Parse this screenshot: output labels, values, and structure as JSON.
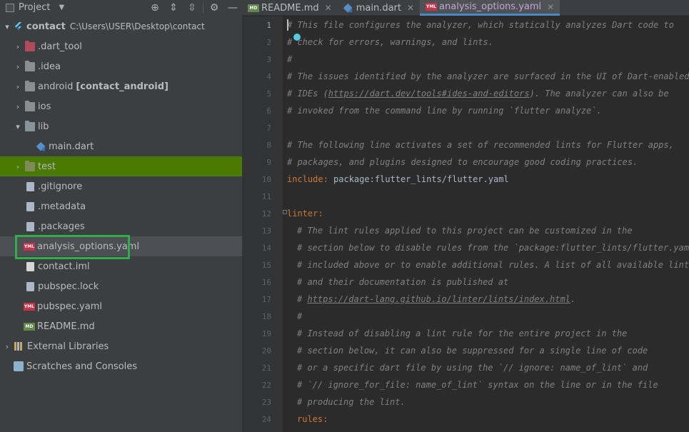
{
  "project_panel": {
    "title": "Project",
    "toolbar_icons": [
      "locate-icon",
      "expand-all-icon",
      "collapse-all-icon",
      "gear-icon",
      "hide-icon"
    ],
    "root": {
      "name": "contact",
      "path": "C:\\Users\\USER\\Desktop\\contact"
    },
    "items": [
      {
        "label": ".dart_tool"
      },
      {
        "label": ".idea"
      },
      {
        "label": "android",
        "extra": "[contact_android]"
      },
      {
        "label": "ios"
      },
      {
        "label": "lib"
      },
      {
        "label": "main.dart"
      },
      {
        "label": "test"
      },
      {
        "label": ".gitignore"
      },
      {
        "label": ".metadata"
      },
      {
        "label": ".packages"
      },
      {
        "label": "analysis_options.yaml"
      },
      {
        "label": "contact.iml"
      },
      {
        "label": "pubspec.lock"
      },
      {
        "label": "pubspec.yaml"
      },
      {
        "label": "README.md"
      },
      {
        "label": "External Libraries"
      },
      {
        "label": "Scratches and Consoles"
      }
    ]
  },
  "tabs": [
    {
      "label": "README.md",
      "icon": "MD"
    },
    {
      "label": "main.dart",
      "icon": "dart"
    },
    {
      "label": "analysis_options.yaml",
      "icon": "YML"
    }
  ],
  "editor": {
    "line_numbers": [
      "1",
      "2",
      "3",
      "4",
      "5",
      "6",
      "7",
      "8",
      "9",
      "10",
      "11",
      "12",
      "13",
      "14",
      "15",
      "16",
      "17",
      "18",
      "19",
      "20",
      "21",
      "22",
      "23",
      "24"
    ],
    "lines": [
      "# This file configures the analyzer, which statically analyzes Dart code to",
      "# check for errors, warnings, and lints.",
      "#",
      "# The issues identified by the analyzer are surfaced in the UI of Dart-enabled",
      "# IDEs (",
      "https://dart.dev/tools#ides-and-editors",
      "). The analyzer can also be",
      "# invoked from the command line by running `flutter analyze`.",
      "# The following line activates a set of recommended lints for Flutter apps,",
      "# packages, and plugins designed to encourage good coding practices.",
      "include:",
      " package:flutter_lints/flutter.yaml",
      "linter:",
      "# The lint rules applied to this project can be customized in the",
      "# section below to disable rules from the `package:flutter_lints/flutter.yaml`",
      "# included above or to enable additional rules. A list of all available lints",
      "# and their documentation is published at",
      "# ",
      "https://dart-lang.github.io/linter/lints/index.html",
      ".",
      "#",
      "# Instead of disabling a lint rule for the entire project in the",
      "# section below, it can also be suppressed for a single line of code",
      "# or a specific dart file by using the `// ignore: name_of_lint` and",
      "# `// ignore_for_file: name_of_lint` syntax on the line or in the file",
      "# producing the lint.",
      "rules:"
    ]
  },
  "colors": {
    "selection_green": "#4a7a00",
    "highlight_box": "#2fae4a",
    "keyword": "#cc7832",
    "comment": "#808080"
  }
}
